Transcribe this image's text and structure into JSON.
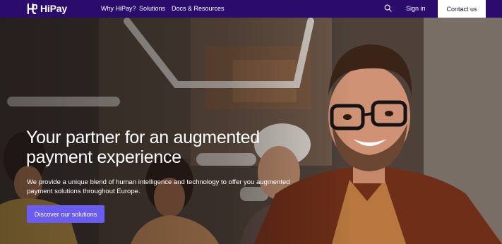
{
  "brand": {
    "name": "HiPay"
  },
  "nav": {
    "links": [
      "Why HiPay?",
      "Solutions",
      "Docs & Resources"
    ],
    "signin": "Sign in",
    "contact": "Contact us"
  },
  "hero": {
    "headline": "Your partner for an augmented payment experience",
    "subtext": "We provide a unique blend of human intelligence and technology to offer you augmented payment solutions throughout Europe.",
    "cta": "Discover our solutions"
  },
  "colors": {
    "nav_bg": "#2b0c6c",
    "cta_bg": "#6a5cf0"
  },
  "icons": [
    "hipay-logo-icon",
    "search-icon"
  ]
}
